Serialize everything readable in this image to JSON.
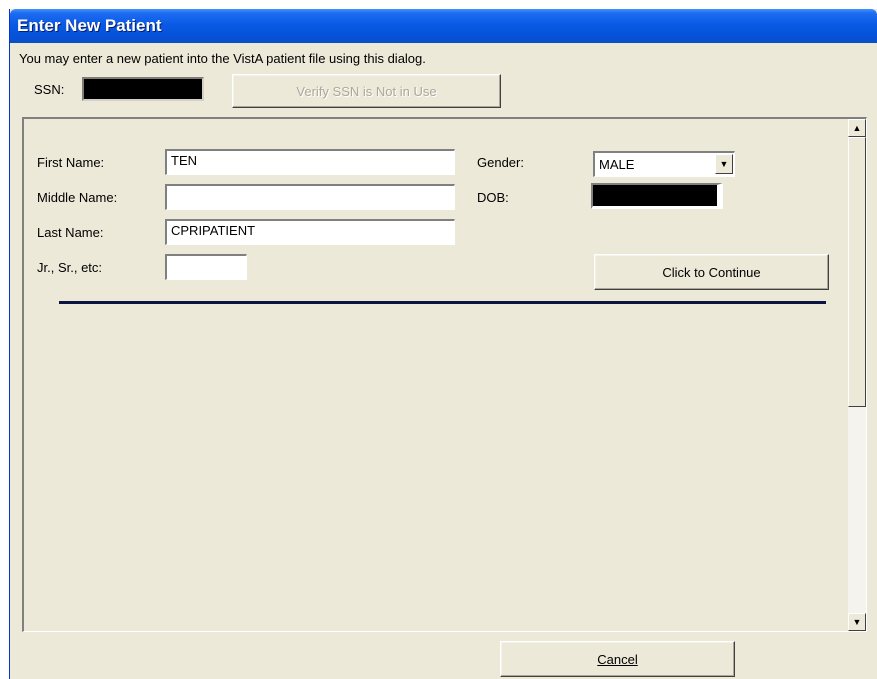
{
  "window": {
    "title": "Enter New Patient"
  },
  "intro_text": "You may enter a new patient into the VistA patient file using this dialog.",
  "ssn": {
    "label": "SSN:",
    "verify_button": "Verify SSN is Not in Use"
  },
  "form": {
    "first_name": {
      "label": "First Name:",
      "value": "TEN"
    },
    "middle_name": {
      "label": "Middle Name:",
      "value": ""
    },
    "last_name": {
      "label": "Last Name:",
      "value": "CPRIPATIENT"
    },
    "suffix": {
      "label": "Jr., Sr., etc:",
      "value": ""
    },
    "gender": {
      "label": "Gender:",
      "value": "MALE"
    },
    "dob": {
      "label": "DOB:"
    },
    "continue_button": "Click to Continue"
  },
  "footer": {
    "cancel_button": "Cancel"
  },
  "icons": {
    "scroll_up": "arrow-up-icon",
    "scroll_down": "arrow-down-icon",
    "dropdown": "chevron-down-icon"
  },
  "colors": {
    "titlebar": "#0a5ae6",
    "window_bg": "#ece9d8",
    "divider": "#0b1540"
  }
}
